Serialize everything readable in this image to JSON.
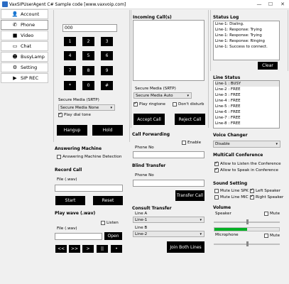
{
  "window": {
    "title": "VaxSIPUserAgent C# Sample code [www.vaxvoip.com]",
    "minimize": "—",
    "maximize": "☐",
    "close": "✕"
  },
  "nav": {
    "items": [
      {
        "label": "Account",
        "icon": "user-icon",
        "glyph": "👤"
      },
      {
        "label": "Phone",
        "icon": "phone-icon",
        "glyph": "✆"
      },
      {
        "label": "Video",
        "icon": "video-icon",
        "glyph": "🎥"
      },
      {
        "label": "Chat",
        "icon": "chat-icon",
        "glyph": "▭"
      },
      {
        "label": "BusyLamp",
        "icon": "busylamp-icon",
        "glyph": "👥"
      },
      {
        "label": "Setting",
        "icon": "gear-icon",
        "glyph": "⚙"
      },
      {
        "label": "SIP REC",
        "icon": "sip-rec-icon",
        "glyph": "▶"
      }
    ]
  },
  "dialpad": {
    "number": "000",
    "keys": [
      "1",
      "2",
      "3",
      "4",
      "5",
      "6",
      "7",
      "8",
      "9",
      "*",
      "0",
      "#"
    ],
    "secure_label": "Secure Media (SRTP)",
    "secure_value": "Secure Media None",
    "play_dial_tone": "Play dial tone",
    "hangup": "Hangup",
    "hold": "Hold"
  },
  "answering": {
    "title": "Answering Machine",
    "detection": "Answering Machine Detection"
  },
  "record": {
    "title": "Record Call",
    "file_label": "File (.wav)",
    "start": "Start",
    "reset": "Reset"
  },
  "playwave": {
    "title": "Play wave (.wav)",
    "listen": "Listen",
    "file_label": "File (.wav)",
    "open": "Open",
    "controls": [
      "<<",
      ">>",
      ">",
      "||",
      "•"
    ]
  },
  "incoming": {
    "title": "Incoming Call(s)",
    "secure_label": "Secure Media (SRTP)",
    "secure_value": "Secure Media Auto",
    "play_ringtone": "Play ringtone",
    "dont_disturb": "Don't disturb",
    "accept": "Accept Call",
    "reject": "Reject Call"
  },
  "forwarding": {
    "title": "Call Forwarding",
    "enable": "Enable",
    "phone_label": "Phone No"
  },
  "blind": {
    "title": "Blind Transfer",
    "phone_label": "Phone No",
    "transfer": "Transfer Call"
  },
  "consult": {
    "title": "Consult Transfer",
    "line_a_label": "Line A",
    "line_a_value": "Line-1",
    "line_b_label": "Line B",
    "line_b_value": "Line-2",
    "join": "Join Both Lines"
  },
  "status_log": {
    "title": "Status Log",
    "lines": [
      "Line-1: Dialing.",
      "Line-1: Response: Trying",
      "Line-1: Response: Trying",
      "Line-1: Response: Ringing",
      "Line-1: Success to connect."
    ],
    "clear": "Clear"
  },
  "line_status": {
    "title": "Line Status",
    "lines": [
      "Line-1 : BUSY",
      "Line-2 : FREE",
      "Line-3 : FREE",
      "Line-4 : FREE",
      "Line-5 : FREE",
      "Line-6 : FREE",
      "Line-7 : FREE",
      "Line-8 : FREE"
    ]
  },
  "voice_changer": {
    "title": "Voice Changer",
    "value": "Disable"
  },
  "multicall": {
    "title": "MultiCall Conference",
    "listen": "Allow to Listen the Conference",
    "speak": "Allow to Speak in Conference"
  },
  "sound": {
    "title": "Sound Setting",
    "mute_spk": "Mute Line SPK",
    "left_speaker": "Left Speaker",
    "mute_mic": "Mute Line MIC",
    "right_speaker": "Right Speaker"
  },
  "volume": {
    "title": "Volume",
    "speaker": "Speaker",
    "speaker_mute": "Mute",
    "microphone": "Microphone",
    "mic_mute": "Mute",
    "speaker_level": 0.5,
    "mic_level": 0.5
  }
}
